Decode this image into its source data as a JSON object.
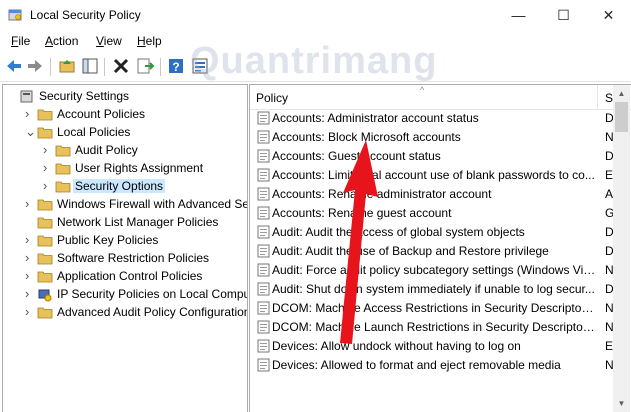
{
  "window": {
    "title": "Local Security Policy",
    "controls": {
      "minimize": "—",
      "maximize": "☐",
      "close": "✕"
    }
  },
  "menu": [
    {
      "label": "File",
      "underline": "F",
      "rest": "ile"
    },
    {
      "label": "Action",
      "underline": "A",
      "rest": "ction"
    },
    {
      "label": "View",
      "underline": "V",
      "rest": "iew"
    },
    {
      "label": "Help",
      "underline": "H",
      "rest": "elp"
    }
  ],
  "toolbar": {
    "icons": [
      "back-arrow-icon",
      "forward-arrow-icon",
      "up-folder-icon",
      "show-hide-tree-icon",
      "delete-icon",
      "export-list-icon",
      "help-icon",
      "properties-icon"
    ]
  },
  "watermark": "Quantrimang",
  "tree": [
    {
      "label": "Security Settings",
      "level": 0,
      "expander": "",
      "selected": false
    },
    {
      "label": "Account Policies",
      "level": 1,
      "expander": ">",
      "selected": false
    },
    {
      "label": "Local Policies",
      "level": 1,
      "expander": "v",
      "selected": false
    },
    {
      "label": "Audit Policy",
      "level": 2,
      "expander": ">",
      "selected": false
    },
    {
      "label": "User Rights Assignment",
      "level": 2,
      "expander": ">",
      "selected": false
    },
    {
      "label": "Security Options",
      "level": 2,
      "expander": ">",
      "selected": true
    },
    {
      "label": "Windows Firewall with Advanced Secu",
      "level": 1,
      "expander": ">",
      "selected": false
    },
    {
      "label": "Network List Manager Policies",
      "level": 1,
      "expander": "",
      "selected": false
    },
    {
      "label": "Public Key Policies",
      "level": 1,
      "expander": ">",
      "selected": false
    },
    {
      "label": "Software Restriction Policies",
      "level": 1,
      "expander": ">",
      "selected": false
    },
    {
      "label": "Application Control Policies",
      "level": 1,
      "expander": ">",
      "selected": false
    },
    {
      "label": "IP Security Policies on Local Compute",
      "level": 1,
      "expander": ">",
      "selected": false
    },
    {
      "label": "Advanced Audit Policy Configuration",
      "level": 1,
      "expander": ">",
      "selected": false
    }
  ],
  "list": {
    "header": {
      "policy": "Policy",
      "setting": "S"
    },
    "rows": [
      {
        "policy": "Accounts: Administrator account status",
        "setting": "D"
      },
      {
        "policy": "Accounts: Block Microsoft accounts",
        "setting": "N"
      },
      {
        "policy": "Accounts: Guest account status",
        "setting": "D"
      },
      {
        "policy": "Accounts: Limit local account use of blank passwords to co...",
        "setting": "E"
      },
      {
        "policy": "Accounts: Rename administrator account",
        "setting": "A"
      },
      {
        "policy": "Accounts: Rename guest account",
        "setting": "G"
      },
      {
        "policy": "Audit: Audit the access of global system objects",
        "setting": "D"
      },
      {
        "policy": "Audit: Audit the use of Backup and Restore privilege",
        "setting": "D"
      },
      {
        "policy": "Audit: Force audit policy subcategory settings (Windows Vis...",
        "setting": "N"
      },
      {
        "policy": "Audit: Shut down system immediately if unable to log secur...",
        "setting": "D"
      },
      {
        "policy": "DCOM: Machine Access Restrictions in Security Descriptor D...",
        "setting": "N"
      },
      {
        "policy": "DCOM: Machine Launch Restrictions in Security Descriptor ...",
        "setting": "N"
      },
      {
        "policy": "Devices: Allow undock without having to log on",
        "setting": "E"
      },
      {
        "policy": "Devices: Allowed to format and eject removable media",
        "setting": "N"
      }
    ]
  },
  "colors": {
    "selection": "#cce8ff",
    "annotation_arrow": "#e8141c",
    "folder": "#e8c15a"
  }
}
